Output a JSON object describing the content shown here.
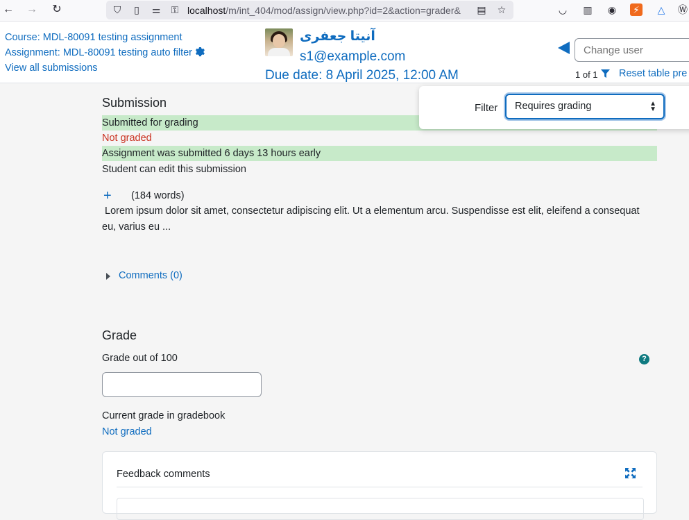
{
  "browser": {
    "url_host": "localhost",
    "url_path": "/m/int_404/mod/assign/view.php?id=2&action=grader&"
  },
  "header": {
    "course_link": "Course: MDL-80091 testing assignment",
    "assignment_link": "Assignment: MDL-80091 testing auto filter",
    "view_all_link": "View all submissions",
    "user_name": "آنیتا جعفری",
    "user_email": "s1@example.com",
    "due_date": "Due date: 8 April 2025, 12:00 AM",
    "change_user_placeholder": "Change user",
    "count": "1 of 1",
    "reset_link": "Reset table pre"
  },
  "filter": {
    "label": "Filter",
    "selected": "Requires grading"
  },
  "submission": {
    "title": "Submission",
    "status_submitted": "Submitted for grading",
    "status_graded": "Not graded",
    "timing": "Assignment was submitted 6 days 13 hours early",
    "edit_status": "Student can edit this submission",
    "word_count": "(184 words)",
    "excerpt": "Lorem ipsum dolor sit amet, consectetur adipiscing elit. Ut a elementum arcu. Suspendisse est elit, eleifend a consequat eu, varius eu ...",
    "comments_link": "Comments (0)"
  },
  "grade": {
    "title": "Grade",
    "grade_out_of_label": "Grade out of 100",
    "grade_value": "",
    "current_grade_label": "Current grade in gradebook",
    "current_grade_value": "Not graded"
  },
  "feedback": {
    "title": "Feedback comments"
  },
  "colors": {
    "link": "#0f6cbf",
    "success_bg": "#c7eac9",
    "danger": "#ca3120",
    "help": "#0f7a80"
  }
}
